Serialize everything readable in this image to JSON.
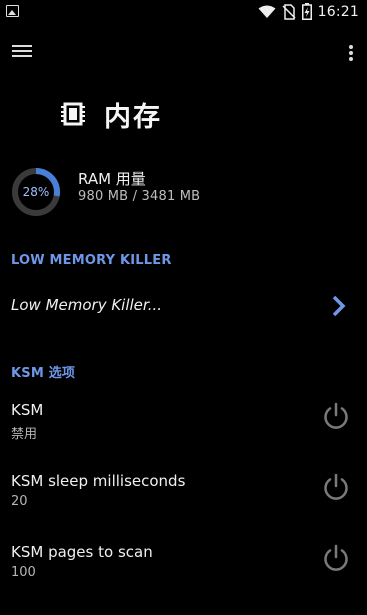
{
  "status_bar": {
    "time": "16:21",
    "icons": [
      "image-notification-icon",
      "wifi-icon",
      "no-sim-icon",
      "battery-charging-icon"
    ]
  },
  "app_bar": {
    "menu_icon": "hamburger-menu-icon",
    "overflow_icon": "more-vert-icon"
  },
  "header": {
    "icon": "memory-chip-icon",
    "title": "内存"
  },
  "ram": {
    "percent": 28,
    "percent_label": "28%",
    "title": "RAM 用量",
    "value": "980 MB / 3481 MB",
    "gauge_color": "#4a7fd6",
    "track_color": "#3a3a3a"
  },
  "lmk_section": {
    "header": "LOW MEMORY KILLER",
    "item_label": "Low Memory Killer...",
    "chevron_icon": "chevron-right-icon"
  },
  "ksm_section": {
    "header": "KSM 选项",
    "items": [
      {
        "title": "KSM",
        "value": "禁用",
        "icon": "power-icon"
      },
      {
        "title": "KSM sleep milliseconds",
        "value": "20",
        "icon": "power-icon"
      },
      {
        "title": "KSM pages to scan",
        "value": "100",
        "icon": "power-icon"
      }
    ]
  },
  "colors": {
    "accent": "#6f97e8",
    "background": "#000000"
  }
}
